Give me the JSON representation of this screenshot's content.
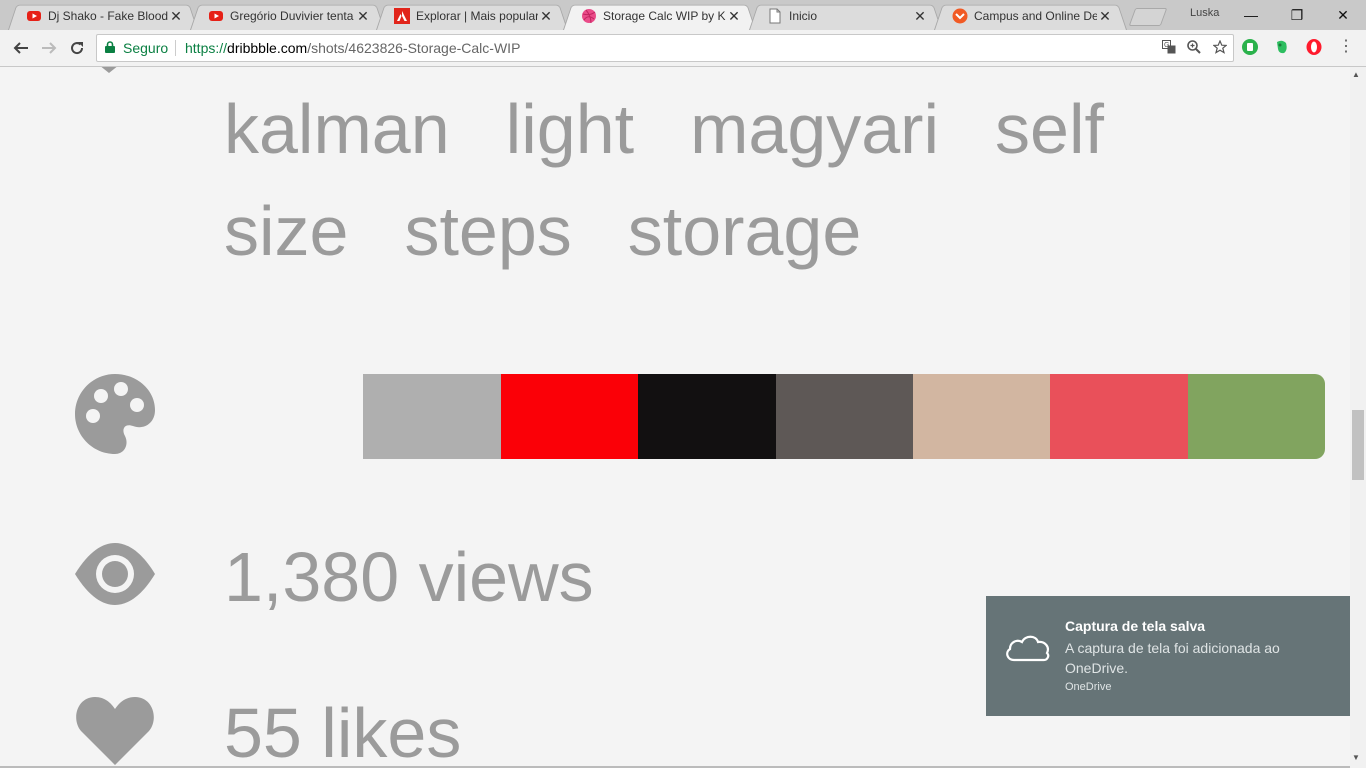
{
  "tabs": [
    {
      "title": "Dj Shako - Fake Blood -",
      "favicon": "youtube-icon"
    },
    {
      "title": "Gregório Duvivier tenta",
      "favicon": "youtube-icon"
    },
    {
      "title": "Explorar | Mais populare",
      "favicon": "adobe-icon"
    },
    {
      "title": "Storage Calc WIP by Kál",
      "favicon": "dribbble-icon"
    },
    {
      "title": "Inicio",
      "favicon": "page-icon"
    },
    {
      "title": "Campus and Online Deg",
      "favicon": "udacity-icon"
    }
  ],
  "active_tab": 3,
  "profile": "Luska",
  "window_controls": {
    "minimize": "—",
    "restore": "❐",
    "close": "✕"
  },
  "toolbar": {
    "secure_label": "Seguro",
    "url_scheme": "https://",
    "url_host": "dribbble.com",
    "url_path": "/shots/4623826-Storage-Calc-WIP"
  },
  "tags": {
    "line1": [
      "kalman",
      "light",
      "magyari",
      "self"
    ],
    "line2": [
      "size",
      "steps",
      "storage"
    ]
  },
  "palette": [
    "#f4f4f4",
    "#afafaf",
    "#fb0007",
    "#121011",
    "#5e5856",
    "#d2b6a1",
    "#e9505a",
    "#81a45f"
  ],
  "stats": {
    "views": "1,380 views",
    "likes": "55 likes"
  },
  "toast": {
    "title": "Captura de tela salva",
    "body": "A captura de tela foi adicionada ao OneDrive.",
    "source": "OneDrive"
  },
  "colors": {
    "icon_gray": "#9b9b9b",
    "secure_green": "#0b8043",
    "toast_bg": "#667477"
  }
}
